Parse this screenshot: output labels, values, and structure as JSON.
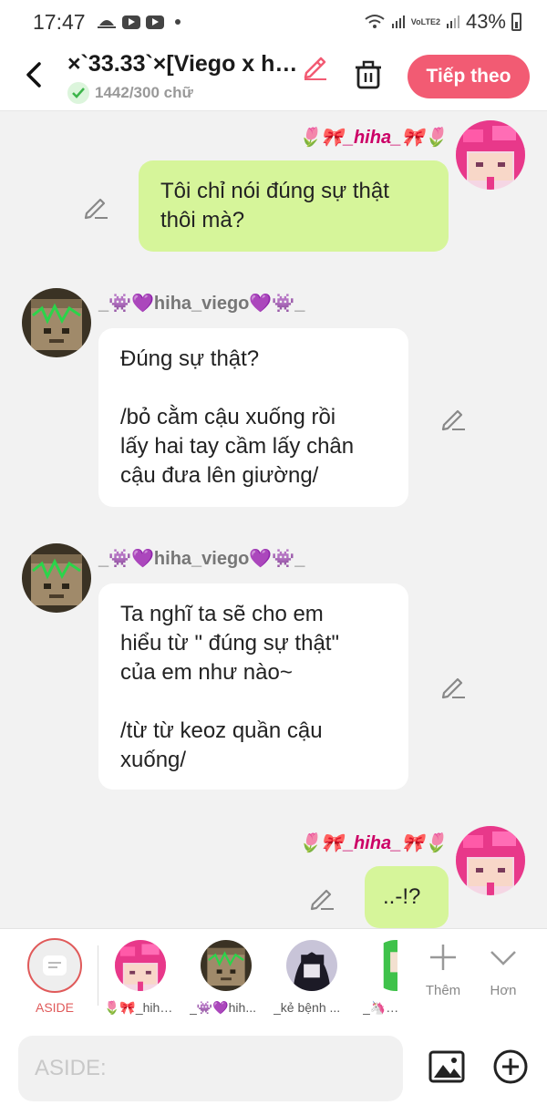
{
  "status_bar": {
    "time": "17:47",
    "network": "VoLTE2",
    "battery": "43%"
  },
  "header": {
    "title": "×`33.33`×[Viego x h…",
    "word_count": "1442/300 chữ",
    "next_label": "Tiếp theo"
  },
  "messages": [
    {
      "side": "right",
      "name": "🌷🎀_hiha_🎀🌷",
      "text": "Tôi chỉ nói đúng sự thật\nthôi mà?"
    },
    {
      "side": "left",
      "name": "_👾💜hiha_viego💜👾_",
      "text": "Đúng sự thật?\n\n/bỏ cằm cậu xuống rồi\nlấy hai tay cầm lấy chân\ncậu đưa lên giường/"
    },
    {
      "side": "left",
      "name": "_👾💜hiha_viego💜👾_",
      "text": "Ta nghĩ ta sẽ cho em\nhiểu từ \" đúng sự thật\"\ncủa em như nào~\n\n/từ từ keoz quần cậu\nxuống/"
    },
    {
      "side": "right",
      "name": "🌷🎀_hiha_🎀🌷",
      "text": "..-!?"
    }
  ],
  "characters": {
    "aside_label": "ASIDE",
    "items": [
      {
        "label": "🌷🎀_hiha..."
      },
      {
        "label": "_👾💜hih..."
      },
      {
        "label": "_kẻ bệnh ..."
      },
      {
        "label": "_🦄🌼"
      }
    ],
    "add_label": "Thêm",
    "more_label": "Hơn"
  },
  "input": {
    "placeholder": "ASIDE:"
  },
  "colors": {
    "accent": "#f25b73",
    "bubble_self": "#d6f59a",
    "bubble_other": "#ffffff",
    "aside": "#e05a5a"
  }
}
